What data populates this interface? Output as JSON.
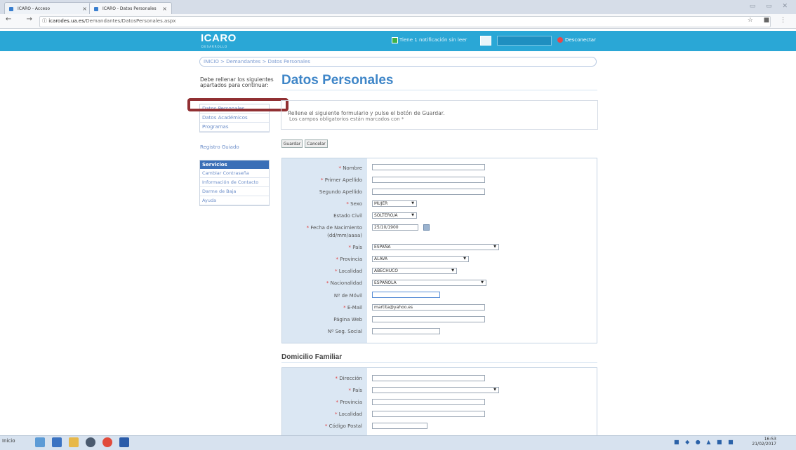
{
  "browser": {
    "tabs": [
      {
        "label": "ICARO - Acceso"
      },
      {
        "label": "ICARO - Datos Personales"
      }
    ],
    "tab_close": "×",
    "window_controls": "▭ ▭ ✕",
    "nav": "← → C",
    "url_domain": "icarodes.ua.es",
    "url_path": "/Demandantes/DatosPersonales.aspx",
    "right_icons": "☆ ■ ⋮"
  },
  "header": {
    "logo": "ICARO",
    "logo_sub": "DESARROLLO",
    "notification": "Tiene 1 notificación sin leer",
    "logout": "Desconectar"
  },
  "breadcrumb": "INICIO > Demandantes > Datos Personales",
  "left": {
    "info": "Debe rellenar los siguientes apartados para continuar:",
    "nav": [
      "Datos Personales",
      "Datos Académicos",
      "Programas"
    ],
    "registro": "Registro Guiado",
    "services_title": "Servicios",
    "services": [
      "Cambiar Contraseña",
      "Información de Contacto",
      "Darme de Baja",
      "Ayuda"
    ]
  },
  "main": {
    "title": "Datos Personales",
    "info_line1": "Rellene el siguiente formulario y pulse el botón de Guardar.",
    "info_line2": "Los campos obligatorios están marcados con *",
    "save_label": "Guardar",
    "cancel_label": "Cancelar"
  },
  "form": {
    "required_mark": "*",
    "nombre_label": "Nombre",
    "apellido1_label": "Primer Apellido",
    "apellido2_label": "Segundo Apellido",
    "sexo_label": "Sexo",
    "sexo_value": "MUJER",
    "estado_label": "Estado Civil",
    "estado_value": "SOLTERO/A",
    "fecha_label": "Fecha de Nacimiento",
    "fecha_hint": "(dd/mm/aaaa)",
    "fecha_value": "25/10/1900",
    "pais_label": "País",
    "pais_value": "ESPAÑA",
    "provincia_label": "Provincia",
    "provincia_value": "ALAVA",
    "localidad_label": "Localidad",
    "localidad_value": "ABECHUCO",
    "nacionalidad_label": "Nacionalidad",
    "nacionalidad_value": "ESPAÑOLA",
    "movil_label": "Nº de Móvil",
    "email_label": "E-Mail",
    "email_value": "martita@yahoo.es",
    "web_label": "Página Web",
    "ss_label": "Nº Seg. Social"
  },
  "domicilio": {
    "title": "Domicilio Familiar",
    "direccion_label": "Dirección",
    "pais_label": "País",
    "provincia_label": "Provincia",
    "localidad_label": "Localidad",
    "cp_label": "Código Postal"
  },
  "taskbar": {
    "start": "Inicio",
    "time": "16:53",
    "date": "21/02/2017"
  }
}
